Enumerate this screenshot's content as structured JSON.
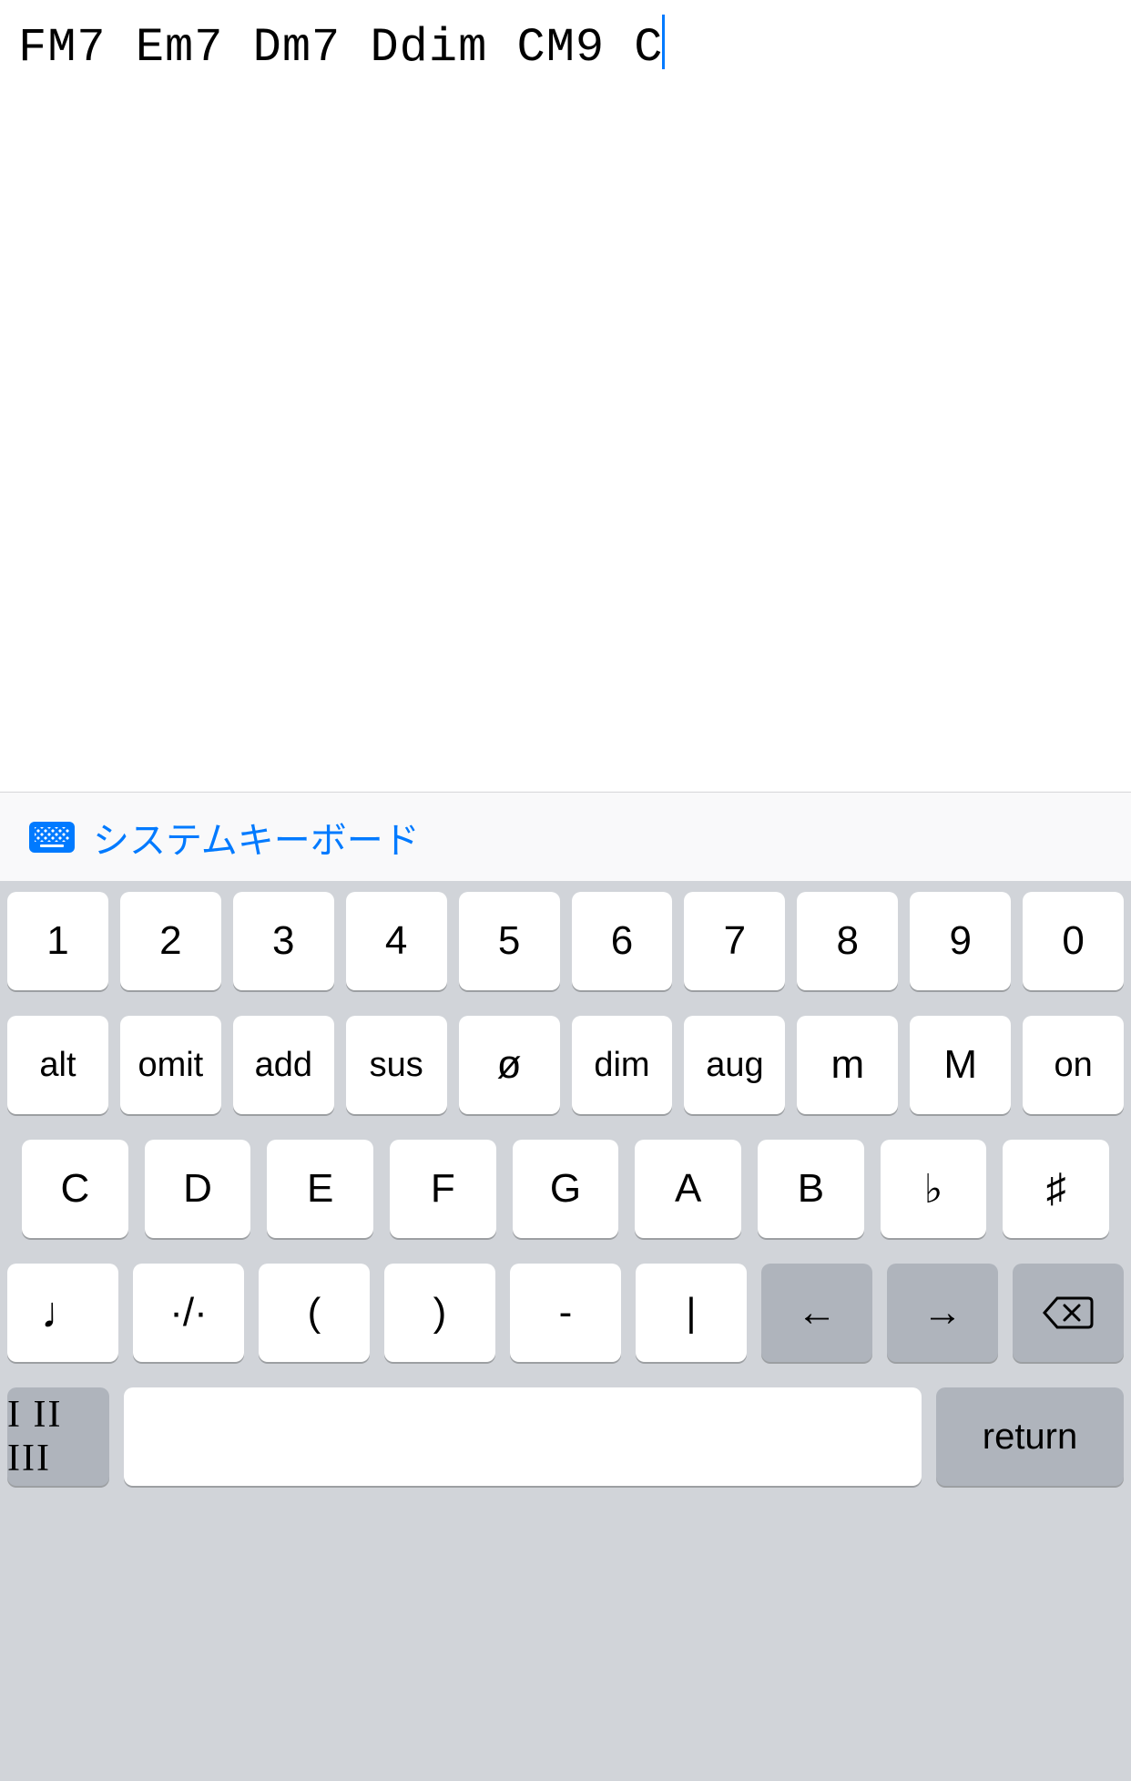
{
  "editor": {
    "text": "FM7 Em7 Dm7 Ddim CM9 C"
  },
  "toolbar": {
    "switch_label": "システムキーボード"
  },
  "keyboard": {
    "row1": [
      "1",
      "2",
      "3",
      "4",
      "5",
      "6",
      "7",
      "8",
      "9",
      "0"
    ],
    "row2": [
      "alt",
      "omit",
      "add",
      "sus",
      "ø",
      "dim",
      "aug",
      "m",
      "M",
      "on"
    ],
    "row3": [
      "C",
      "D",
      "E",
      "F",
      "G",
      "A",
      "B",
      "♭",
      "♯"
    ],
    "row4": {
      "keys": [
        "♩",
        "·/·",
        "(",
        ")",
        "-",
        "|",
        "←",
        "→"
      ],
      "backspace": "⌫"
    },
    "row5": {
      "mode": "I II III",
      "return": "return"
    }
  }
}
